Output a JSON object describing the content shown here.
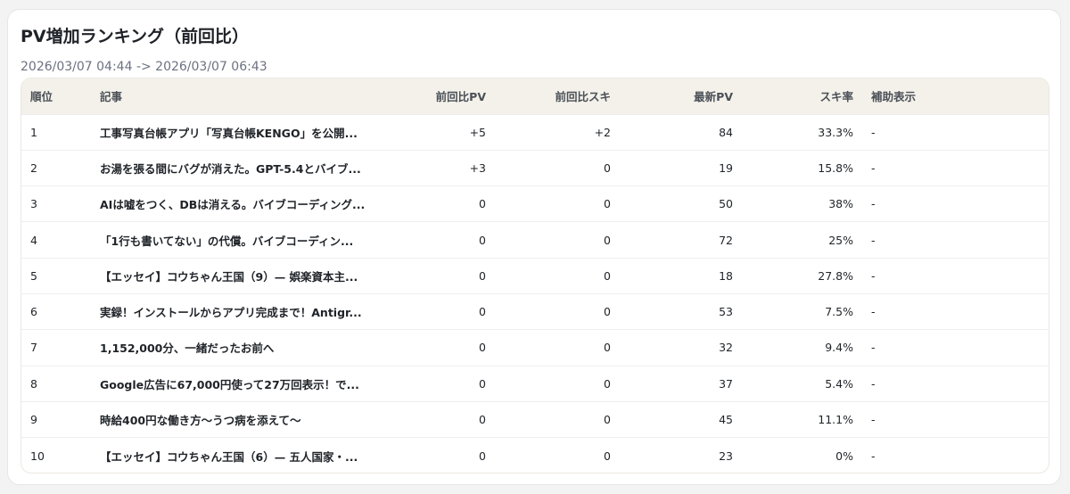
{
  "title": "PV増加ランキング（前回比）",
  "period": "2026/03/07 04:44 -> 2026/03/07 06:43",
  "columns": {
    "rank": "順位",
    "article": "記事",
    "pv_diff": "前回比PV",
    "suki_diff": "前回比スキ",
    "latest_pv": "最新PV",
    "suki_rate": "スキ率",
    "aux": "補助表示"
  },
  "rows": [
    {
      "rank": "1",
      "article": "工事写真台帳アプリ「写真台帳KENGO」を公開...",
      "pv_diff": "+5",
      "suki_diff": "+2",
      "latest_pv": "84",
      "suki_rate": "33.3%",
      "aux": "-"
    },
    {
      "rank": "2",
      "article": "お湯を張る間にバグが消えた。GPT-5.4とバイブ...",
      "pv_diff": "+3",
      "suki_diff": "0",
      "latest_pv": "19",
      "suki_rate": "15.8%",
      "aux": "-"
    },
    {
      "rank": "3",
      "article": "AIは嘘をつく、DBは消える。バイブコーディング...",
      "pv_diff": "0",
      "suki_diff": "0",
      "latest_pv": "50",
      "suki_rate": "38%",
      "aux": "-"
    },
    {
      "rank": "4",
      "article": "「1行も書いてない」の代償。バイブコーディン...",
      "pv_diff": "0",
      "suki_diff": "0",
      "latest_pv": "72",
      "suki_rate": "25%",
      "aux": "-"
    },
    {
      "rank": "5",
      "article": "【エッセイ】コウちゃん王国（9）— 娯楽資本主...",
      "pv_diff": "0",
      "suki_diff": "0",
      "latest_pv": "18",
      "suki_rate": "27.8%",
      "aux": "-"
    },
    {
      "rank": "6",
      "article": "実録！インストールからアプリ完成まで！Antigr...",
      "pv_diff": "0",
      "suki_diff": "0",
      "latest_pv": "53",
      "suki_rate": "7.5%",
      "aux": "-"
    },
    {
      "rank": "7",
      "article": "1,152,000分、一緒だったお前へ",
      "pv_diff": "0",
      "suki_diff": "0",
      "latest_pv": "32",
      "suki_rate": "9.4%",
      "aux": "-"
    },
    {
      "rank": "8",
      "article": "Google広告に67,000円使って27万回表示！で...",
      "pv_diff": "0",
      "suki_diff": "0",
      "latest_pv": "37",
      "suki_rate": "5.4%",
      "aux": "-"
    },
    {
      "rank": "9",
      "article": "時給400円な働き方〜うつ病を添えて〜",
      "pv_diff": "0",
      "suki_diff": "0",
      "latest_pv": "45",
      "suki_rate": "11.1%",
      "aux": "-"
    },
    {
      "rank": "10",
      "article": "【エッセイ】コウちゃん王国（6）— 五人国家・...",
      "pv_diff": "0",
      "suki_diff": "0",
      "latest_pv": "23",
      "suki_rate": "0%",
      "aux": "-"
    }
  ]
}
